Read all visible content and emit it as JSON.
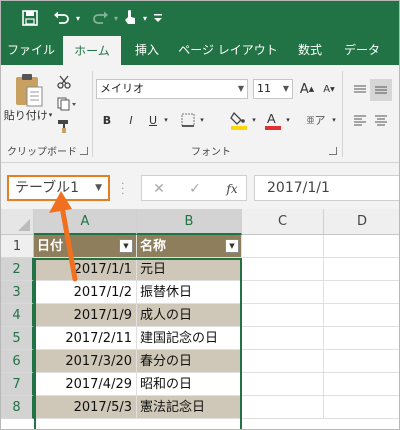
{
  "quick_access": {
    "save_icon": "save-icon",
    "undo_icon": "undo-icon",
    "redo_icon": "redo-icon",
    "touch_icon": "touch-mode-icon",
    "customize_icon": "customize-qat-icon"
  },
  "tabs": [
    {
      "label": "ファイル",
      "active": false
    },
    {
      "label": "ホーム",
      "active": true
    },
    {
      "label": "挿入",
      "active": false
    },
    {
      "label": "ページ レイアウト",
      "active": false
    },
    {
      "label": "数式",
      "active": false
    },
    {
      "label": "データ",
      "active": false
    }
  ],
  "ribbon": {
    "clipboard": {
      "paste_label": "貼り付け",
      "group_label": "クリップボード"
    },
    "font": {
      "font_name": "メイリオ",
      "font_size": "11",
      "group_label": "フォント",
      "bold": "B",
      "italic": "I",
      "underline": "U",
      "font_color": "#e03030",
      "fill_color": "#ffd700"
    }
  },
  "formula_bar": {
    "name_box": "テーブル1",
    "fx_label": "fx",
    "formula_value": "2017/1/1"
  },
  "sheet": {
    "columns": [
      "A",
      "B",
      "C",
      "D"
    ],
    "row_numbers": [
      "1",
      "2",
      "3",
      "4",
      "5",
      "6",
      "7",
      "8"
    ],
    "table_headers": [
      "日付",
      "名称"
    ],
    "rows": [
      {
        "date": "2017/1/1",
        "name": "元日"
      },
      {
        "date": "2017/1/2",
        "name": "振替休日"
      },
      {
        "date": "2017/1/9",
        "name": "成人の日"
      },
      {
        "date": "2017/2/11",
        "name": "建国記念の日"
      },
      {
        "date": "2017/3/20",
        "name": "春分の日"
      },
      {
        "date": "2017/4/29",
        "name": "昭和の日"
      },
      {
        "date": "2017/5/3",
        "name": "憲法記念日"
      }
    ],
    "header_color": "#8f7e5b",
    "band_color": "#cfc8b8"
  },
  "annotation": {
    "arrow_color": "#f07020"
  }
}
